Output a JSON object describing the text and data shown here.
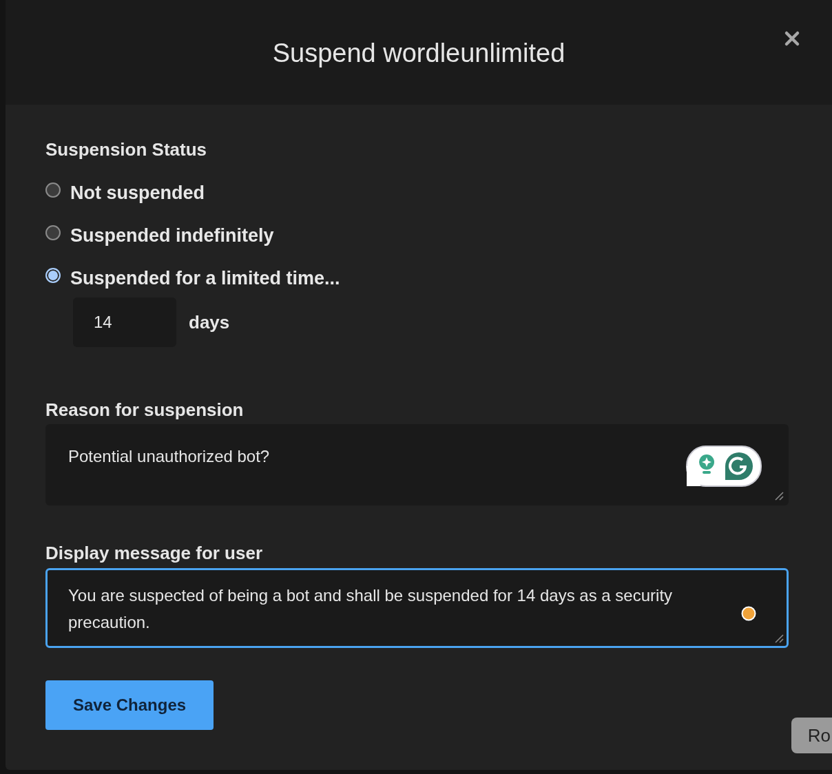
{
  "dialog": {
    "title": "Suspend wordleunlimited"
  },
  "suspension_status": {
    "label": "Suspension Status",
    "options": [
      {
        "label": "Not suspended",
        "selected": false
      },
      {
        "label": "Suspended indefinitely",
        "selected": false
      },
      {
        "label": "Suspended for a limited time...",
        "selected": true
      }
    ],
    "duration": {
      "value": "14",
      "unit": "days"
    }
  },
  "reason": {
    "label": "Reason for suspension",
    "value": "Potential unauthorized bot?",
    "focused": false
  },
  "message": {
    "label": "Display message for user",
    "value": "You are suspected of being a bot and shall be suspended for 14 days as a security precaution.",
    "focused": true
  },
  "save_button": "Save Changes",
  "background_button": "Ro"
}
